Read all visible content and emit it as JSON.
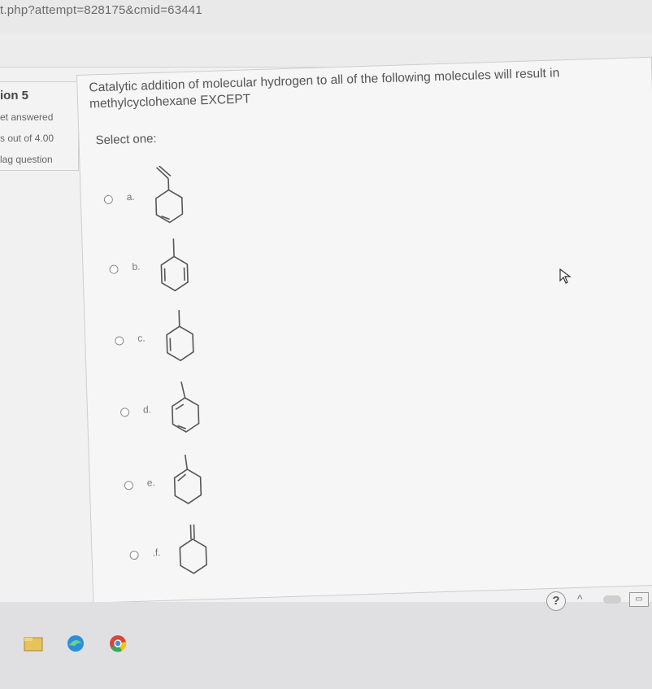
{
  "browser": {
    "url": "t.php?attempt=828175&cmid=63441"
  },
  "question_info": {
    "number_label": "ion 5",
    "state": "et answered",
    "marks": "s out of 4.00",
    "flag": "lag question"
  },
  "question": {
    "text": "Catalytic addition of molecular hydrogen to all of the following molecules will result in methylcyclohexane EXCEPT",
    "select_prompt": "Select one:",
    "options": [
      {
        "label": "a.",
        "molecule_icon": "methylenecyclohexene-icon"
      },
      {
        "label": "b.",
        "molecule_icon": "methylcyclohexadiene-icon"
      },
      {
        "label": "c.",
        "molecule_icon": "methylcyclohexene-icon"
      },
      {
        "label": "d.",
        "molecule_icon": "methylcyclohexadiene-icon"
      },
      {
        "label": "e.",
        "molecule_icon": "methylcyclohexene-icon"
      },
      {
        "label": ".f.",
        "molecule_icon": "methylenecyclohexane-icon"
      }
    ]
  },
  "taskbar": {
    "apps": [
      "file-explorer-icon",
      "edge-icon",
      "chrome-icon"
    ],
    "tray_help": "?"
  }
}
